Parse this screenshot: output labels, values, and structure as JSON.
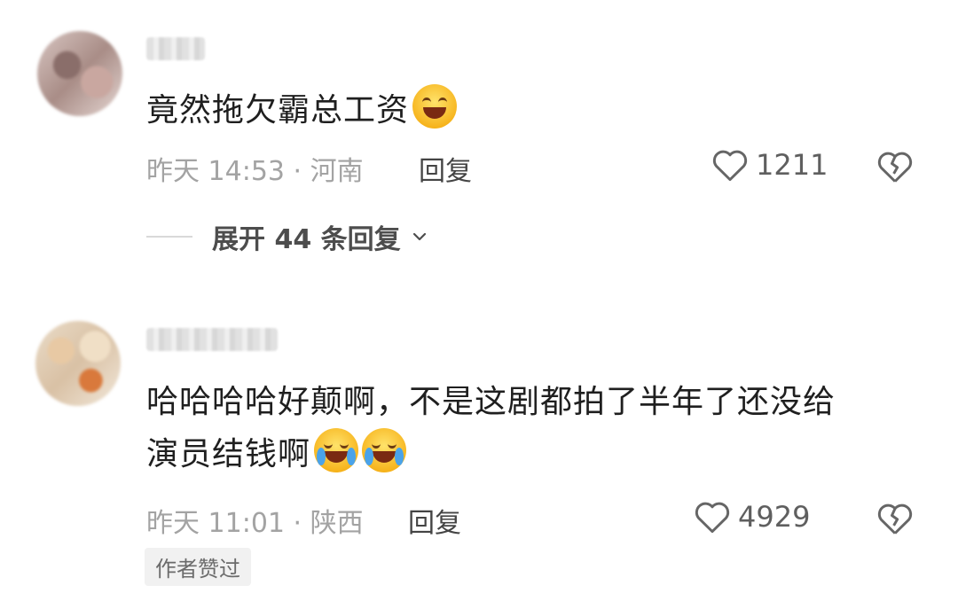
{
  "comments": [
    {
      "text": "竟然拖欠霸总工资",
      "emoji": "grinning-face-emoji",
      "meta": "昨天 14:53 · 河南",
      "reply_label": "回复",
      "like_count": "1211",
      "expand_label": "展开 44 条回复"
    },
    {
      "text_line1": "哈哈哈哈好颠啊，不是这剧都拍了半年了还没给",
      "text_line2": "演员结钱啊",
      "emoji": "loudly-crying-face-emoji",
      "meta": "昨天 11:01 · 陕西",
      "reply_label": "回复",
      "like_count": "4929",
      "badge": "作者赞过"
    }
  ],
  "icons": {
    "like": "heart-outline-icon",
    "dislike": "broken-heart-icon",
    "expand": "chevron-down-icon"
  },
  "colors": {
    "text": "#1f1f1f",
    "meta": "#a3a3a3",
    "icon": "#666666"
  }
}
